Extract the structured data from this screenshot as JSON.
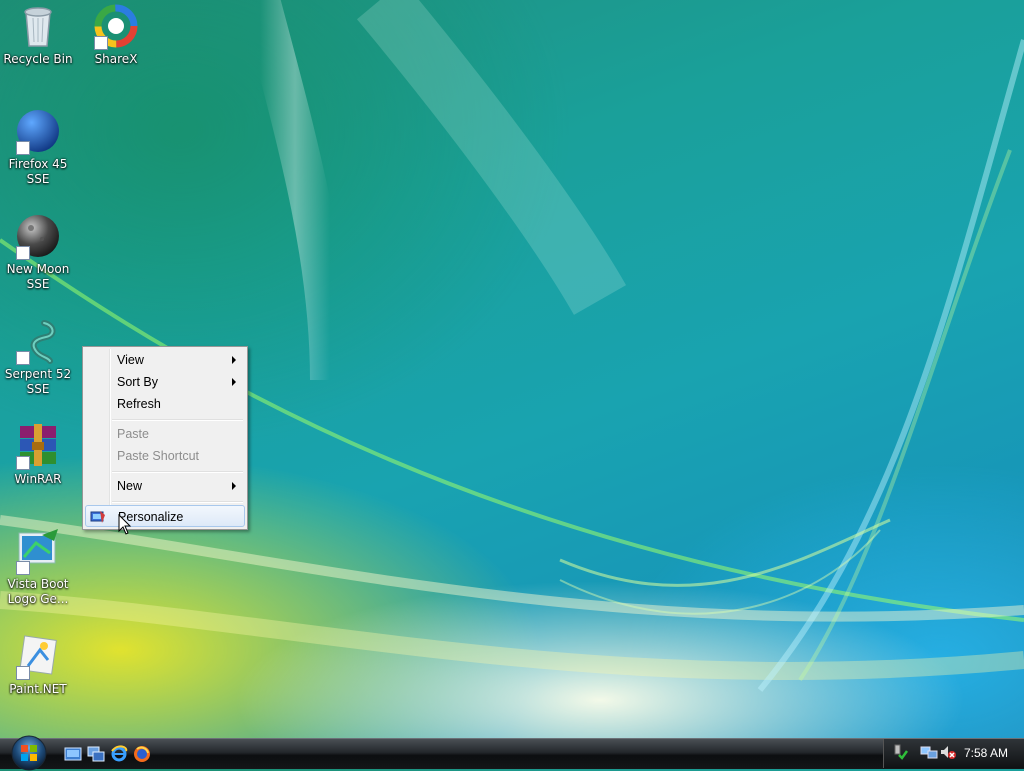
{
  "desktop": {
    "icons": [
      {
        "label": "Recycle Bin",
        "icon": "recycle-bin-icon"
      },
      {
        "label": "ShareX",
        "icon": "sharex-icon"
      },
      {
        "label": "Firefox 45 SSE",
        "icon": "firefox-icon"
      },
      {
        "label": "New Moon SSE",
        "icon": "new-moon-icon"
      },
      {
        "label": "Serpent 52 SSE",
        "icon": "serpent-icon"
      },
      {
        "label": "WinRAR",
        "icon": "winrar-icon"
      },
      {
        "label": "Vista Boot Logo Ge...",
        "icon": "vista-boot-logo-icon"
      },
      {
        "label": "Paint.NET",
        "icon": "paintnet-icon"
      }
    ]
  },
  "context_menu": {
    "items": {
      "view": "View",
      "sort_by": "Sort By",
      "refresh": "Refresh",
      "paste": "Paste",
      "paste_shortcut": "Paste Shortcut",
      "new": "New",
      "personalize": "Personalize"
    }
  },
  "taskbar": {
    "clock": "7:58 AM",
    "quick_launch": [
      "show-desktop-icon",
      "switch-windows-icon",
      "internet-explorer-icon",
      "firefox-icon"
    ],
    "tray": [
      "safely-remove-icon",
      "network-icon",
      "volume-muted-icon"
    ]
  }
}
